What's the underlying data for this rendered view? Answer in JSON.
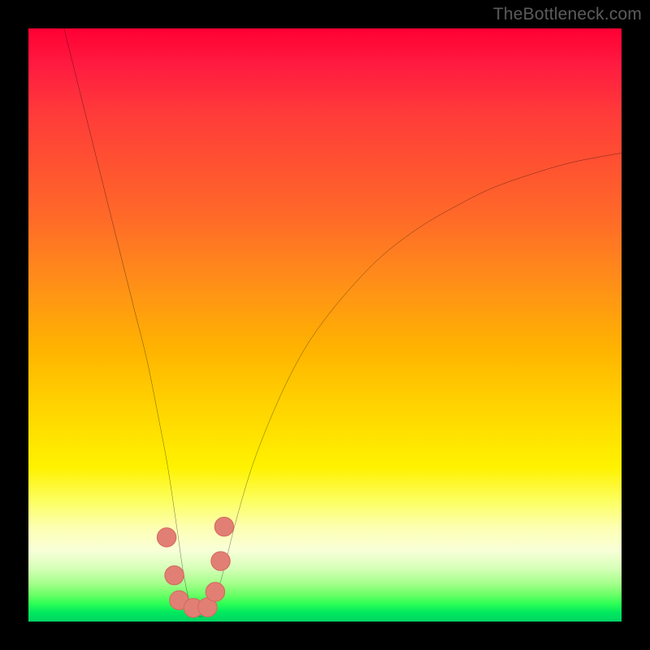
{
  "watermark": {
    "text": "TheBottleneck.com"
  },
  "colors": {
    "curve": "#000000",
    "marker_fill": "#e27f74",
    "marker_stroke": "#d46a60",
    "frame": "#000000"
  },
  "chart_data": {
    "type": "line",
    "title": "",
    "xlabel": "",
    "ylabel": "",
    "xlim": [
      0,
      100
    ],
    "ylim": [
      0,
      100
    ],
    "grid": false,
    "legend": false,
    "note": "V-shaped bottleneck curve on vertical rainbow gradient; y=0 is green (good), y=100 is red (bad). Values are approximate readings from the image in plot-percentage coordinates.",
    "series": [
      {
        "name": "bottleneck-curve",
        "x": [
          6,
          8,
          10,
          12,
          14,
          16,
          18,
          20,
          22,
          23.5,
          25,
          26,
          27,
          28,
          29,
          30,
          31.5,
          33,
          35,
          38,
          42,
          46,
          50,
          55,
          60,
          66,
          72,
          78,
          85,
          92,
          100
        ],
        "y": [
          100,
          92,
          84,
          76,
          68,
          60,
          52,
          44,
          34,
          26,
          16,
          9,
          4,
          1.5,
          0.8,
          1.5,
          4,
          9,
          17,
          27,
          37,
          45,
          51,
          57,
          62,
          66.5,
          70,
          73,
          75.5,
          77.5,
          79
        ]
      }
    ],
    "markers": {
      "name": "highlight-dots",
      "points": [
        {
          "x": 23.3,
          "y": 14.2
        },
        {
          "x": 24.6,
          "y": 7.8
        },
        {
          "x": 25.4,
          "y": 3.6
        },
        {
          "x": 27.8,
          "y": 2.3
        },
        {
          "x": 30.2,
          "y": 2.4
        },
        {
          "x": 31.5,
          "y": 5.0
        },
        {
          "x": 32.4,
          "y": 10.2
        },
        {
          "x": 33.0,
          "y": 16.0
        }
      ],
      "radius_pct": 1.6
    }
  }
}
